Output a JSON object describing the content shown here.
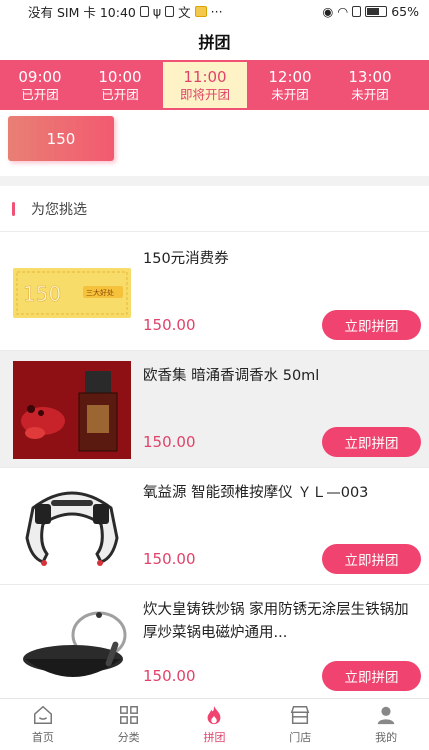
{
  "status_bar": {
    "left_text": "没有 SIM 卡 10:40",
    "dots": "···",
    "battery": "65%"
  },
  "nav": {
    "title": "拼团"
  },
  "time_slots": [
    {
      "time": "09:00",
      "status": "已开团"
    },
    {
      "time": "10:00",
      "status": "已开团"
    },
    {
      "time": "11:00",
      "status": "即将开团"
    },
    {
      "time": "12:00",
      "status": "未开团"
    },
    {
      "time": "13:00",
      "status": "未开团"
    }
  ],
  "coupon_chip": {
    "label": "150"
  },
  "section": {
    "title": "为您挑选"
  },
  "products": [
    {
      "name": "150元消费券",
      "price": "150.00",
      "button": "立即拼团",
      "thumb_text": "150",
      "thumb_tag": "三大好处"
    },
    {
      "name": "欧香集 暗涌香调香水 50ml",
      "price": "150.00",
      "button": "立即拼团"
    },
    {
      "name": "氧益源 智能颈椎按摩仪 ＹＬ—003",
      "price": "150.00",
      "button": "立即拼团"
    },
    {
      "name": "炊大皇铸铁炒锅 家用防锈无涂层生铁锅加厚炒菜锅电磁炉通用...",
      "price": "150.00",
      "button": "立即拼团"
    }
  ],
  "tabs": [
    {
      "label": "首页",
      "icon": "home-icon"
    },
    {
      "label": "分类",
      "icon": "grid-icon"
    },
    {
      "label": "拼团",
      "icon": "flame-icon"
    },
    {
      "label": "门店",
      "icon": "store-icon"
    },
    {
      "label": "我的",
      "icon": "user-icon"
    }
  ],
  "colors": {
    "accent": "#f05276",
    "button": "#f0436f",
    "price": "#e0436a",
    "active_slot_bg": "#fdf3c6"
  }
}
